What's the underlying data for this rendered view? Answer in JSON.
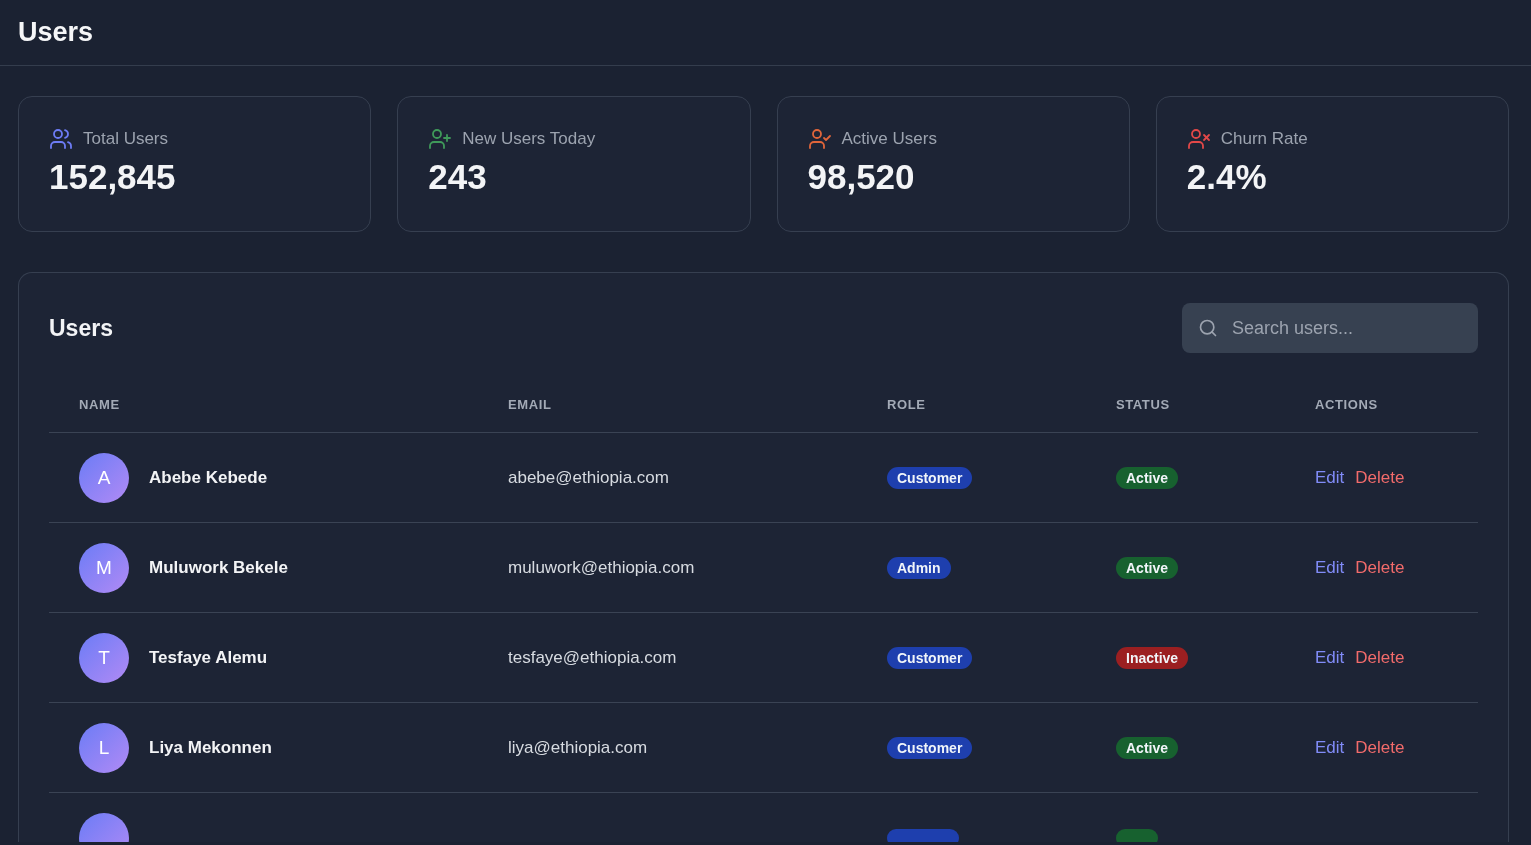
{
  "header": {
    "title": "Users"
  },
  "stats": [
    {
      "kind": "users",
      "label": "Total Users",
      "value": "152,845",
      "color": "#6d7cf5"
    },
    {
      "kind": "user-plus",
      "label": "New Users Today",
      "value": "243",
      "color": "#3f9a5a"
    },
    {
      "kind": "user-check",
      "label": "Active Users",
      "value": "98,520",
      "color": "#e0653a"
    },
    {
      "kind": "user-x",
      "label": "Churn Rate",
      "value": "2.4%",
      "color": "#e34848"
    }
  ],
  "table": {
    "title": "Users",
    "search": {
      "placeholder": "Search users..."
    },
    "columns": [
      "NAME",
      "EMAIL",
      "ROLE",
      "STATUS",
      "ACTIONS"
    ],
    "rows": [
      {
        "initial": "A",
        "name": "Abebe Kebede",
        "email": "abebe@ethiopia.com",
        "role": "Customer",
        "status": "Active",
        "color": "#17612f",
        "actions": [
          "Edit",
          "Delete"
        ]
      },
      {
        "initial": "M",
        "name": "Muluwork Bekele",
        "email": "muluwork@ethiopia.com",
        "role": "Admin",
        "status": "Active",
        "color": "#17612f",
        "actions": [
          "Edit",
          "Delete"
        ]
      },
      {
        "initial": "T",
        "name": "Tesfaye Alemu",
        "email": "tesfaye@ethiopia.com",
        "role": "Customer",
        "status": "Inactive",
        "color": "#9b1f21",
        "actions": [
          "Edit",
          "Delete"
        ]
      },
      {
        "initial": "L",
        "name": "Liya Mekonnen",
        "email": "liya@ethiopia.com",
        "role": "Customer",
        "status": "Active",
        "color": "#17612f",
        "actions": [
          "Edit",
          "Delete"
        ]
      }
    ],
    "partial_row": {
      "color": "#17612f"
    }
  }
}
